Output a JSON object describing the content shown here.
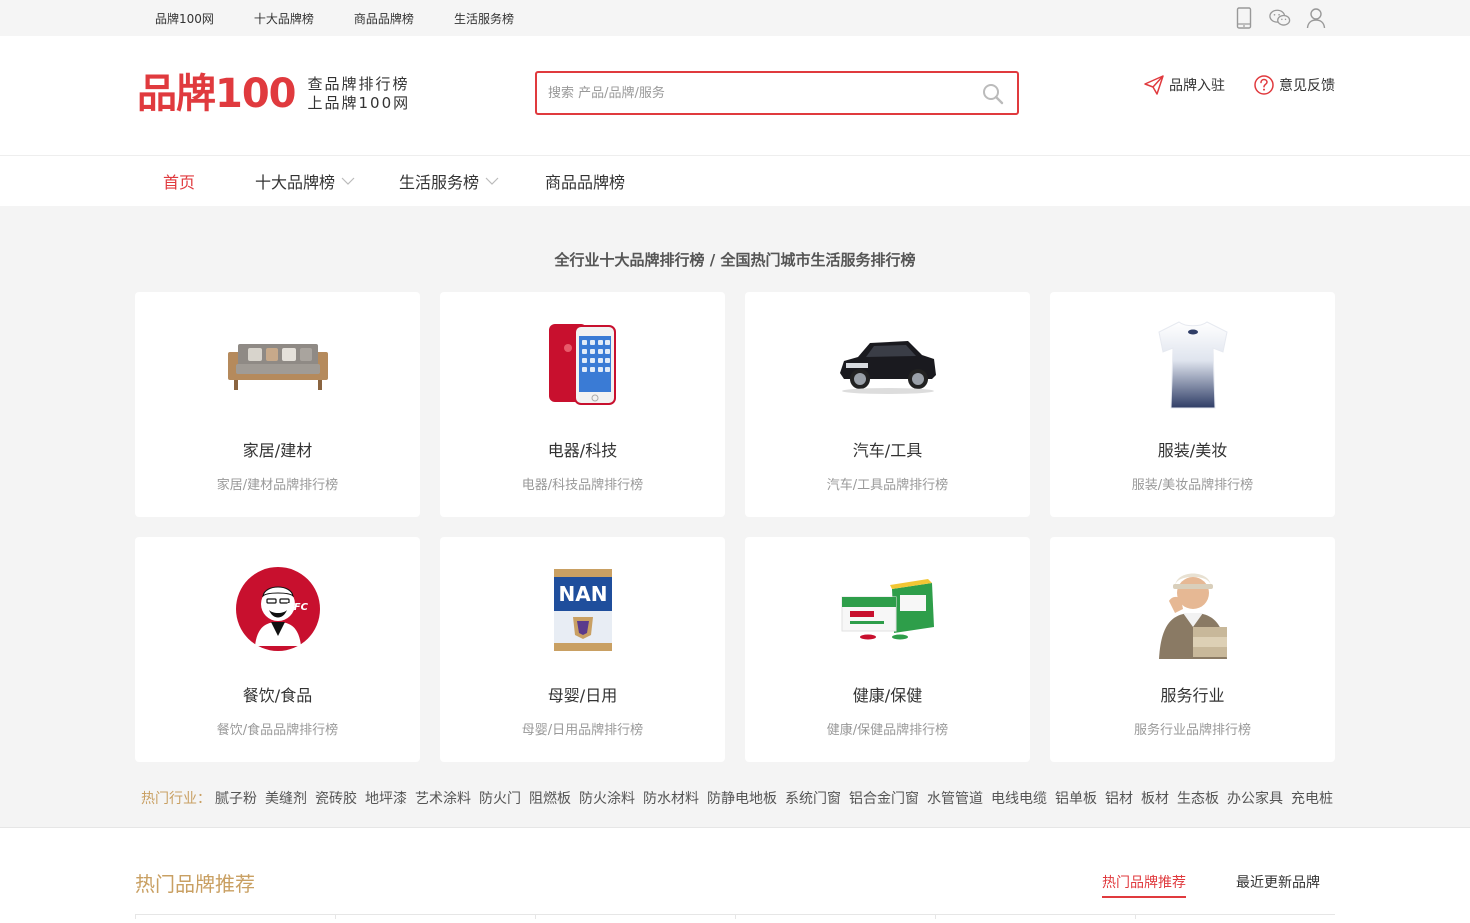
{
  "topbar": {
    "links": [
      "品牌100网",
      "十大品牌榜",
      "商品品牌榜",
      "生活服务榜"
    ],
    "icons": [
      "mobile-icon",
      "wechat-icon",
      "user-icon"
    ]
  },
  "header": {
    "logo_text": "品牌100",
    "slogan_line1": "查品牌排行榜",
    "slogan_line2": "上品牌100网",
    "search_placeholder": "搜索 产品/品牌/服务",
    "brand_join": "品牌入驻",
    "feedback": "意见反馈"
  },
  "nav": {
    "items": [
      {
        "label": "首页",
        "active": true
      },
      {
        "label": "十大品牌榜",
        "dropdown": true
      },
      {
        "label": "生活服务榜",
        "dropdown": true
      },
      {
        "label": "商品品牌榜"
      }
    ]
  },
  "categories": {
    "title": "全行业十大品牌排行榜 / 全国热门城市生活服务排行榜",
    "cards": [
      {
        "name": "家居/建材",
        "sub": "家居/建材品牌排行榜"
      },
      {
        "name": "电器/科技",
        "sub": "电器/科技品牌排行榜"
      },
      {
        "name": "汽车/工具",
        "sub": "汽车/工具品牌排行榜"
      },
      {
        "name": "服装/美妆",
        "sub": "服装/美妆品牌排行榜"
      },
      {
        "name": "餐饮/食品",
        "sub": "餐饮/食品品牌排行榜"
      },
      {
        "name": "母婴/日用",
        "sub": "母婴/日用品牌排行榜"
      },
      {
        "name": "健康/保健",
        "sub": "健康/保健品牌排行榜"
      },
      {
        "name": "服务行业",
        "sub": "服务行业品牌排行榜"
      }
    ],
    "kfc_text": "KFC",
    "nan_text": "NAN",
    "hot_label": "热门行业：",
    "hot_items": [
      "腻子粉",
      "美缝剂",
      "瓷砖胶",
      "地坪漆",
      "艺术涂料",
      "防火门",
      "阻燃板",
      "防火涂料",
      "防水材料",
      "防静电地板",
      "系统门窗",
      "铝合金门窗",
      "水管管道",
      "电线电缆",
      "铝单板",
      "铝材",
      "板材",
      "生态板",
      "办公家具",
      "充电桩"
    ]
  },
  "recommend": {
    "title": "热门品牌推荐",
    "tabs": [
      "热门品牌推荐",
      "最近更新品牌"
    ]
  },
  "colors": {
    "accent": "#e03a3e",
    "gold": "#c9a063"
  }
}
